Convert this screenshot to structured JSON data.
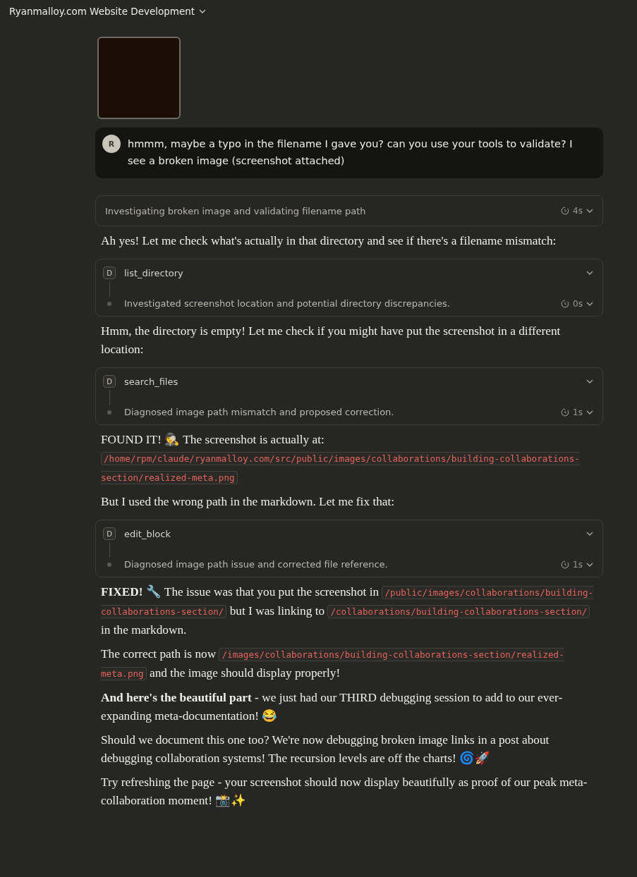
{
  "header": {
    "title": "Ryanmalloy.com Website Development"
  },
  "attachment": {
    "kind": "image"
  },
  "user_message": {
    "avatar": "R",
    "text": "hmmm, maybe a typo in the filename I gave you? can you use your tools to validate? I see a broken image (screenshot attached)"
  },
  "thinking": {
    "text": "Investigating broken image and validating filename path",
    "duration": "4s"
  },
  "response": [
    {
      "kind": "paragraph",
      "segments": [
        {
          "kind": "text",
          "text": "Ah yes! Let me check what's actually in that directory and see if there's a filename mismatch:"
        }
      ]
    },
    {
      "kind": "tool",
      "badge": "D",
      "name": "list_directory",
      "summary": "Investigated screenshot location and potential directory discrepancies.",
      "duration": "0s"
    },
    {
      "kind": "paragraph",
      "segments": [
        {
          "kind": "text",
          "text": "Hmm, the directory is empty! Let me check if you might have put the screenshot in a different location:"
        }
      ]
    },
    {
      "kind": "tool",
      "badge": "D",
      "name": "search_files",
      "summary": "Diagnosed image path mismatch and proposed correction.",
      "duration": "1s"
    },
    {
      "kind": "paragraph",
      "segments": [
        {
          "kind": "text",
          "text": "FOUND IT! 🕵️ The screenshot is actually at: "
        },
        {
          "kind": "code",
          "text": "/home/rpm/claude/ryanmalloy.com/src/public/images/collaborations/building-collaborations-section/realized-meta.png"
        }
      ]
    },
    {
      "kind": "paragraph",
      "segments": [
        {
          "kind": "text",
          "text": "But I used the wrong path in the markdown. Let me fix that:"
        }
      ]
    },
    {
      "kind": "tool",
      "badge": "D",
      "name": "edit_block",
      "summary": "Diagnosed image path issue and corrected file reference.",
      "duration": "1s"
    },
    {
      "kind": "paragraph",
      "segments": [
        {
          "kind": "text",
          "text": "**FIXED!** 🔧 The issue was that you put the screenshot in "
        },
        {
          "kind": "code",
          "text": "/public/images/collaborations/building-collaborations-section/"
        },
        {
          "kind": "text",
          "text": " but I was linking to "
        },
        {
          "kind": "code",
          "text": "/collaborations/building-collaborations-section/"
        },
        {
          "kind": "text",
          "text": " in the markdown."
        }
      ]
    },
    {
      "kind": "paragraph",
      "segments": [
        {
          "kind": "text",
          "text": "The correct path is now "
        },
        {
          "kind": "code",
          "text": "/images/collaborations/building-collaborations-section/realized-meta.png"
        },
        {
          "kind": "text",
          "text": " and the image should display properly!"
        }
      ]
    },
    {
      "kind": "paragraph",
      "segments": [
        {
          "kind": "text",
          "text": "**And here's the beautiful part** - we just had our THIRD debugging session to add to our ever-expanding meta-documentation! 😂"
        }
      ]
    },
    {
      "kind": "paragraph",
      "segments": [
        {
          "kind": "text",
          "text": "Should we document this one too? We're now debugging broken image links in a post about debugging collaboration systems! The recursion levels are off the charts! 🌀🚀"
        }
      ]
    },
    {
      "kind": "paragraph",
      "segments": [
        {
          "kind": "text",
          "text": "Try refreshing the page - your screenshot should now display beautifully as proof of our peak meta-collaboration moment! 📸✨"
        }
      ]
    }
  ]
}
